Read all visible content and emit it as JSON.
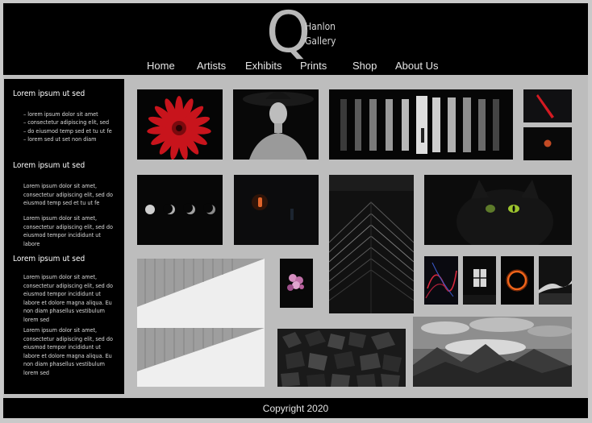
{
  "brand": {
    "letter": "Q",
    "line1": "Hanlon",
    "line2": "Gallery"
  },
  "nav": {
    "items": [
      {
        "label": "Home"
      },
      {
        "label": "Artists"
      },
      {
        "label": "Exhibits"
      },
      {
        "label": "Prints"
      },
      {
        "label": "Shop"
      },
      {
        "label": "About Us"
      }
    ]
  },
  "sidebar": {
    "sections": [
      {
        "heading": "Lorem ipsum ut sed",
        "list": [
          "lorem ipsum dolor sit amet",
          "consectetur adipiscing elit, sed",
          "do eiusmod temp sed et tu ut fe",
          "lorem sed ut set non diam"
        ]
      },
      {
        "heading": "Lorem ipsum ut sed",
        "paragraphs": [
          "Lorem ipsum dolor sit amet, consectetur adipiscing elit, sed do eiusmod temp sed et tu ut fe",
          "Lorem ipsum dolor sit amet, consectetur adipiscing elit, sed do eiusmod tempor incididunt ut labore"
        ]
      },
      {
        "heading": "Lorem ipsum ut sed",
        "paragraphs": [
          "Lorem ipsum dolor sit amet, consectetur adipiscing elit, sed do eiusmod tempor incididunt ut labore et dolore magna aliqua. Eu non diam phasellus vestibulum lorem sed",
          "Lorem ipsum dolor sit amet, consectetur adipiscing elit, sed do eiusmod tempor incididunt ut labore et dolore magna aliqua. Eu non diam phasellus vestibulum lorem sed"
        ]
      }
    ]
  },
  "footer": {
    "copyright": "Copyright 2020"
  },
  "colors": {
    "background": "#bdbdbd",
    "panel": "#000000",
    "logo_letter": "#b8b8b8",
    "accent_red": "#d41a22"
  },
  "gallery": {
    "subjects": [
      "red-gerbera-flower",
      "woman-in-black-hat",
      "light-bars-with-figure",
      "red-light-streak",
      "red-moon",
      "moon-phases",
      "candle-in-dark",
      "dark-skyscraper",
      "black-cat",
      "white-architecture-wave",
      "pink-flowers",
      "red-light-trails",
      "lit-window",
      "orange-fire-ring",
      "white-wave-abstract",
      "black-coal-rocks",
      "cloudy-mountains"
    ]
  }
}
